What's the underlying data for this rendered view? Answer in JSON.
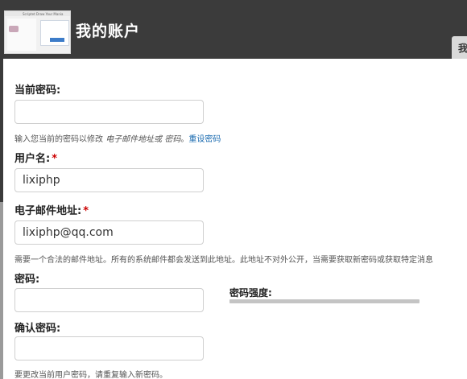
{
  "header": {
    "title": "我的账户",
    "tab_label": "我",
    "thumbnail_text": "Scriptet  Draw Your Mania"
  },
  "form": {
    "current_password": {
      "label": "当前密码:",
      "value": "",
      "hint_prefix": "输入您当前的密码以修改 ",
      "hint_emphasis": "电子邮件地址或 密码",
      "hint_separator": "。",
      "reset_link": "重设密码"
    },
    "username": {
      "label": "用户名:",
      "required_mark": "*",
      "value": "lixiphp"
    },
    "email": {
      "label": "电子邮件地址:",
      "required_mark": "*",
      "value": "lixiphp@qq.com",
      "hint": "需要一个合法的邮件地址。所有的系统邮件都会发送到此地址。此地址不对外公开，当需要获取新密码或获取特定消息"
    },
    "password": {
      "label": "密码:",
      "value": "",
      "strength_label": "密码强度:",
      "strength_fraction": 0
    },
    "confirm_password": {
      "label": "确认密码:",
      "value": "",
      "hint": "要更改当前用户密码，请重复输入新密码。"
    }
  },
  "colors": {
    "header_bg": "#3b3b3b",
    "link": "#1b6bb0",
    "required": "#cc0000"
  }
}
